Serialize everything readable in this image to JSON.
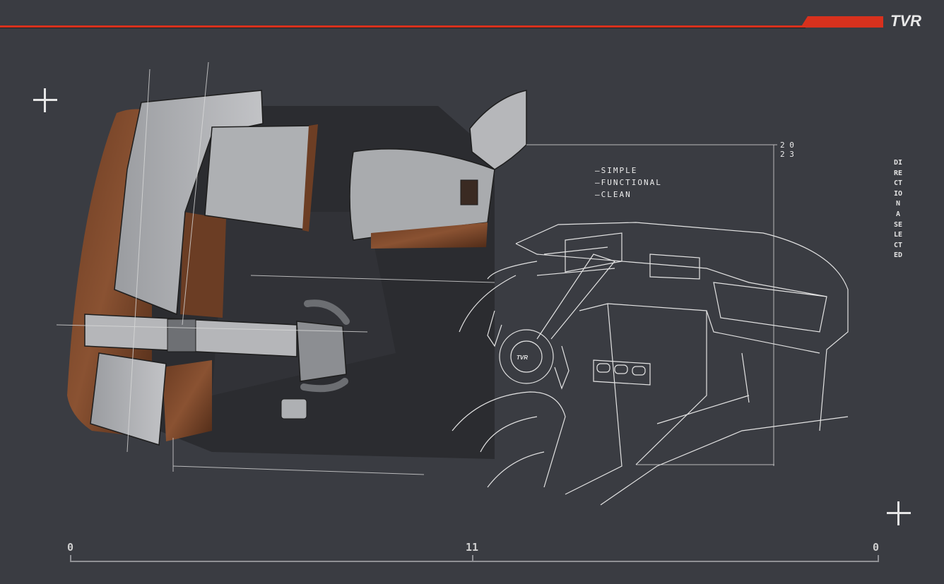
{
  "brand": {
    "logo_text": "TVR",
    "accent_color": "#d8311d",
    "background_color": "#3a3c42"
  },
  "side_caption": "DIRECTION A SELECTED",
  "sketch_notes": [
    "—SIMPLE",
    "—FUNCTIONAL",
    "—CLEAN"
  ],
  "dimension_mark": [
    "2 0",
    "2 3"
  ],
  "badge_text": "TVR",
  "scale_bar": {
    "left_label": "0",
    "middle_label": "11",
    "right_label": "0"
  },
  "icons": [
    "plus-icon",
    "plus-icon"
  ]
}
